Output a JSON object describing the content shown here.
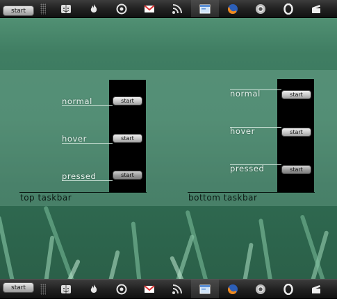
{
  "taskbar": {
    "start_label": "start",
    "icons": [
      {
        "name": "finder-icon",
        "glyph": "finder",
        "active": false
      },
      {
        "name": "flame-icon",
        "glyph": "flame",
        "active": false
      },
      {
        "name": "swirl-icon",
        "glyph": "swirl",
        "active": false
      },
      {
        "name": "gmail-icon",
        "glyph": "gmail",
        "active": false
      },
      {
        "name": "rss-icon",
        "glyph": "rss",
        "active": false
      },
      {
        "name": "window-icon",
        "glyph": "window",
        "active": true
      },
      {
        "name": "firefox-icon",
        "glyph": "firefox",
        "active": false
      },
      {
        "name": "chrome-icon",
        "glyph": "chrome",
        "active": false
      },
      {
        "name": "opera-icon",
        "glyph": "opera",
        "active": false
      },
      {
        "name": "clapper-icon",
        "glyph": "clapper",
        "active": false
      }
    ]
  },
  "preview": {
    "button_label": "start",
    "states": [
      "normal",
      "hover",
      "pressed"
    ],
    "top_caption": "top taskbar",
    "bottom_caption": "bottom taskbar"
  },
  "colors": {
    "wallpaper": "#3f7a60",
    "panel": "#000000",
    "label": "#e8f3ee"
  }
}
